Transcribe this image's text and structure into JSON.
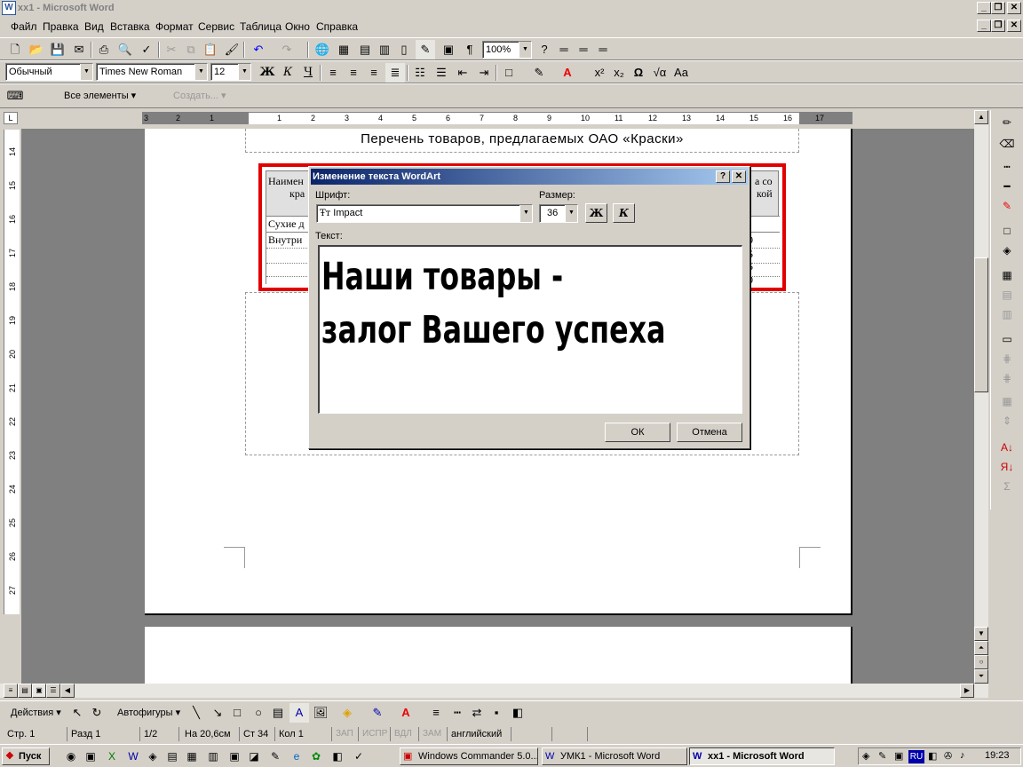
{
  "window": {
    "title": "хх1 - Microsoft Word",
    "app_icon": "word-icon"
  },
  "menu": [
    "Файл",
    "Правка",
    "Вид",
    "Вставка",
    "Формат",
    "Сервис",
    "Таблица",
    "Окно",
    "Справка"
  ],
  "toolbar": {
    "zoom": "100%"
  },
  "format": {
    "style": "Обычный",
    "font": "Times New Roman",
    "size": "12"
  },
  "outline_bar": {
    "all_elements": "Все элементы",
    "create": "Создать..."
  },
  "document": {
    "heading": "Перечень товаров, предлагаемых ОАО  «Краски»",
    "table_fragments": {
      "col1_header": "Наимен",
      "col1_header2": "кра",
      "row1": "Сухие д",
      "row2": "Внутри",
      "col_right_header": "а со",
      "col_right_header2": "кой",
      "vals": [
        "0",
        "5",
        "5",
        "0"
      ]
    }
  },
  "dialog": {
    "title": "Изменение текста WordArt",
    "font_label": "Шрифт:",
    "font_value": "Impact",
    "size_label": "Размер:",
    "size_value": "36",
    "bold_label": "Ж",
    "italic_label": "К",
    "text_label": "Текст:",
    "text_line1": "Наши товары -",
    "text_line2": "залог Вашего успеха",
    "ok": "ОК",
    "cancel": "Отмена"
  },
  "drawbar": {
    "actions": "Действия",
    "autoshapes": "Автофигуры"
  },
  "status": {
    "page": "Стр. 1",
    "section": "Разд 1",
    "pages": "1/2",
    "at": "На 20,6см",
    "line": "Ст 34",
    "col": "Кол 1",
    "rec": "ЗАП",
    "trk": "ИСПР",
    "ext": "ВДЛ",
    "ovr": "ЗАМ",
    "lang": "английский"
  },
  "taskbar": {
    "start": "Пуск",
    "tasks": [
      "Windows Commander 5.0...",
      "УМК1 - Microsoft Word",
      "хх1 - Microsoft Word"
    ],
    "lang": "RU",
    "time": "19:23"
  },
  "ruler": {
    "h": [
      "3",
      "2",
      "1",
      "1",
      "2",
      "3",
      "4",
      "5",
      "6",
      "7",
      "8",
      "9",
      "10",
      "11",
      "12",
      "13",
      "14",
      "15",
      "16",
      "17"
    ],
    "v": [
      "14",
      "15",
      "16",
      "17",
      "18",
      "19",
      "20",
      "21",
      "22",
      "23",
      "24",
      "25",
      "26",
      "27"
    ]
  }
}
